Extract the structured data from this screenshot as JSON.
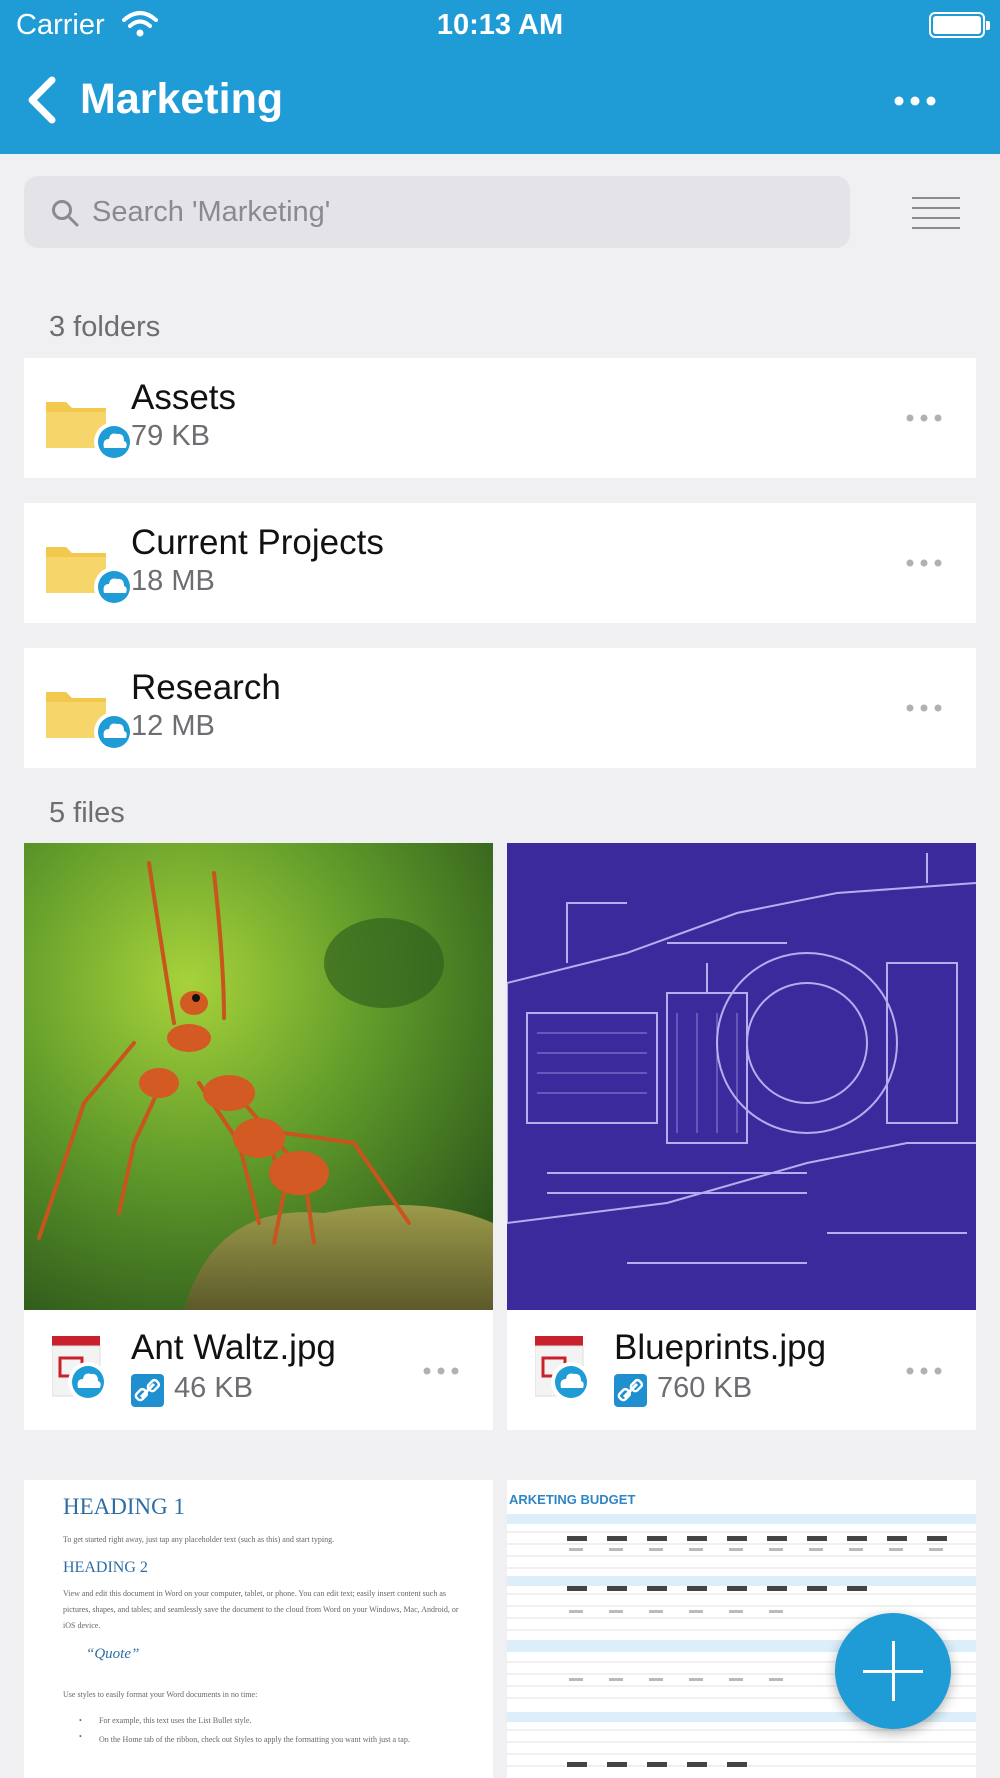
{
  "status_bar": {
    "carrier": "Carrier",
    "time": "10:13 AM"
  },
  "nav": {
    "back_icon": "chevron-left-icon",
    "title": "Marketing",
    "more_icon": "ellipsis-icon"
  },
  "search": {
    "placeholder": "Search 'Marketing'",
    "value": ""
  },
  "sort_icon": "list-sort-icon",
  "folders_label": "3 folders",
  "folders": [
    {
      "name": "Assets",
      "size": "79 KB"
    },
    {
      "name": "Current Projects",
      "size": "18 MB"
    },
    {
      "name": "Research",
      "size": "12 MB"
    }
  ],
  "files_label": "5 files",
  "files": [
    {
      "name": "Ant Waltz.jpg",
      "size": "46 KB",
      "thumb": "ants-photo"
    },
    {
      "name": "Blueprints.jpg",
      "size": "760 KB",
      "thumb": "blueprint-drawing"
    },
    {
      "name": "",
      "size": "",
      "thumb": "word-document",
      "doc": {
        "h1": "HEADING 1",
        "h2": "HEADING 2",
        "quote": "“Quote”",
        "p1": "To get started right away, just tap any placeholder text (such as this) and start typing.",
        "p2": "View and edit this document in Word on your computer, tablet, or phone. You can edit text; easily insert content such as pictures, shapes, and tables; and seamlessly save the document to the cloud from Word on your Windows, Mac, Android, or iOS device.",
        "p3": "Use styles to easily format your Word documents in no time:",
        "b1": "For example, this text uses the List Bullet style.",
        "b2": "On the Home tab of the ribbon, check out Styles to apply the formatting you want with just a tap."
      }
    },
    {
      "name": "",
      "size": "",
      "thumb": "spreadsheet",
      "sheet": {
        "title": "ARKETING BUDGET"
      }
    }
  ],
  "fab": {
    "icon": "plus-icon"
  },
  "colors": {
    "brand": "#1f9bd6",
    "background": "#f0f0f2",
    "folder": "#f2c94c",
    "cloud_badge": "#1f9bd6"
  }
}
